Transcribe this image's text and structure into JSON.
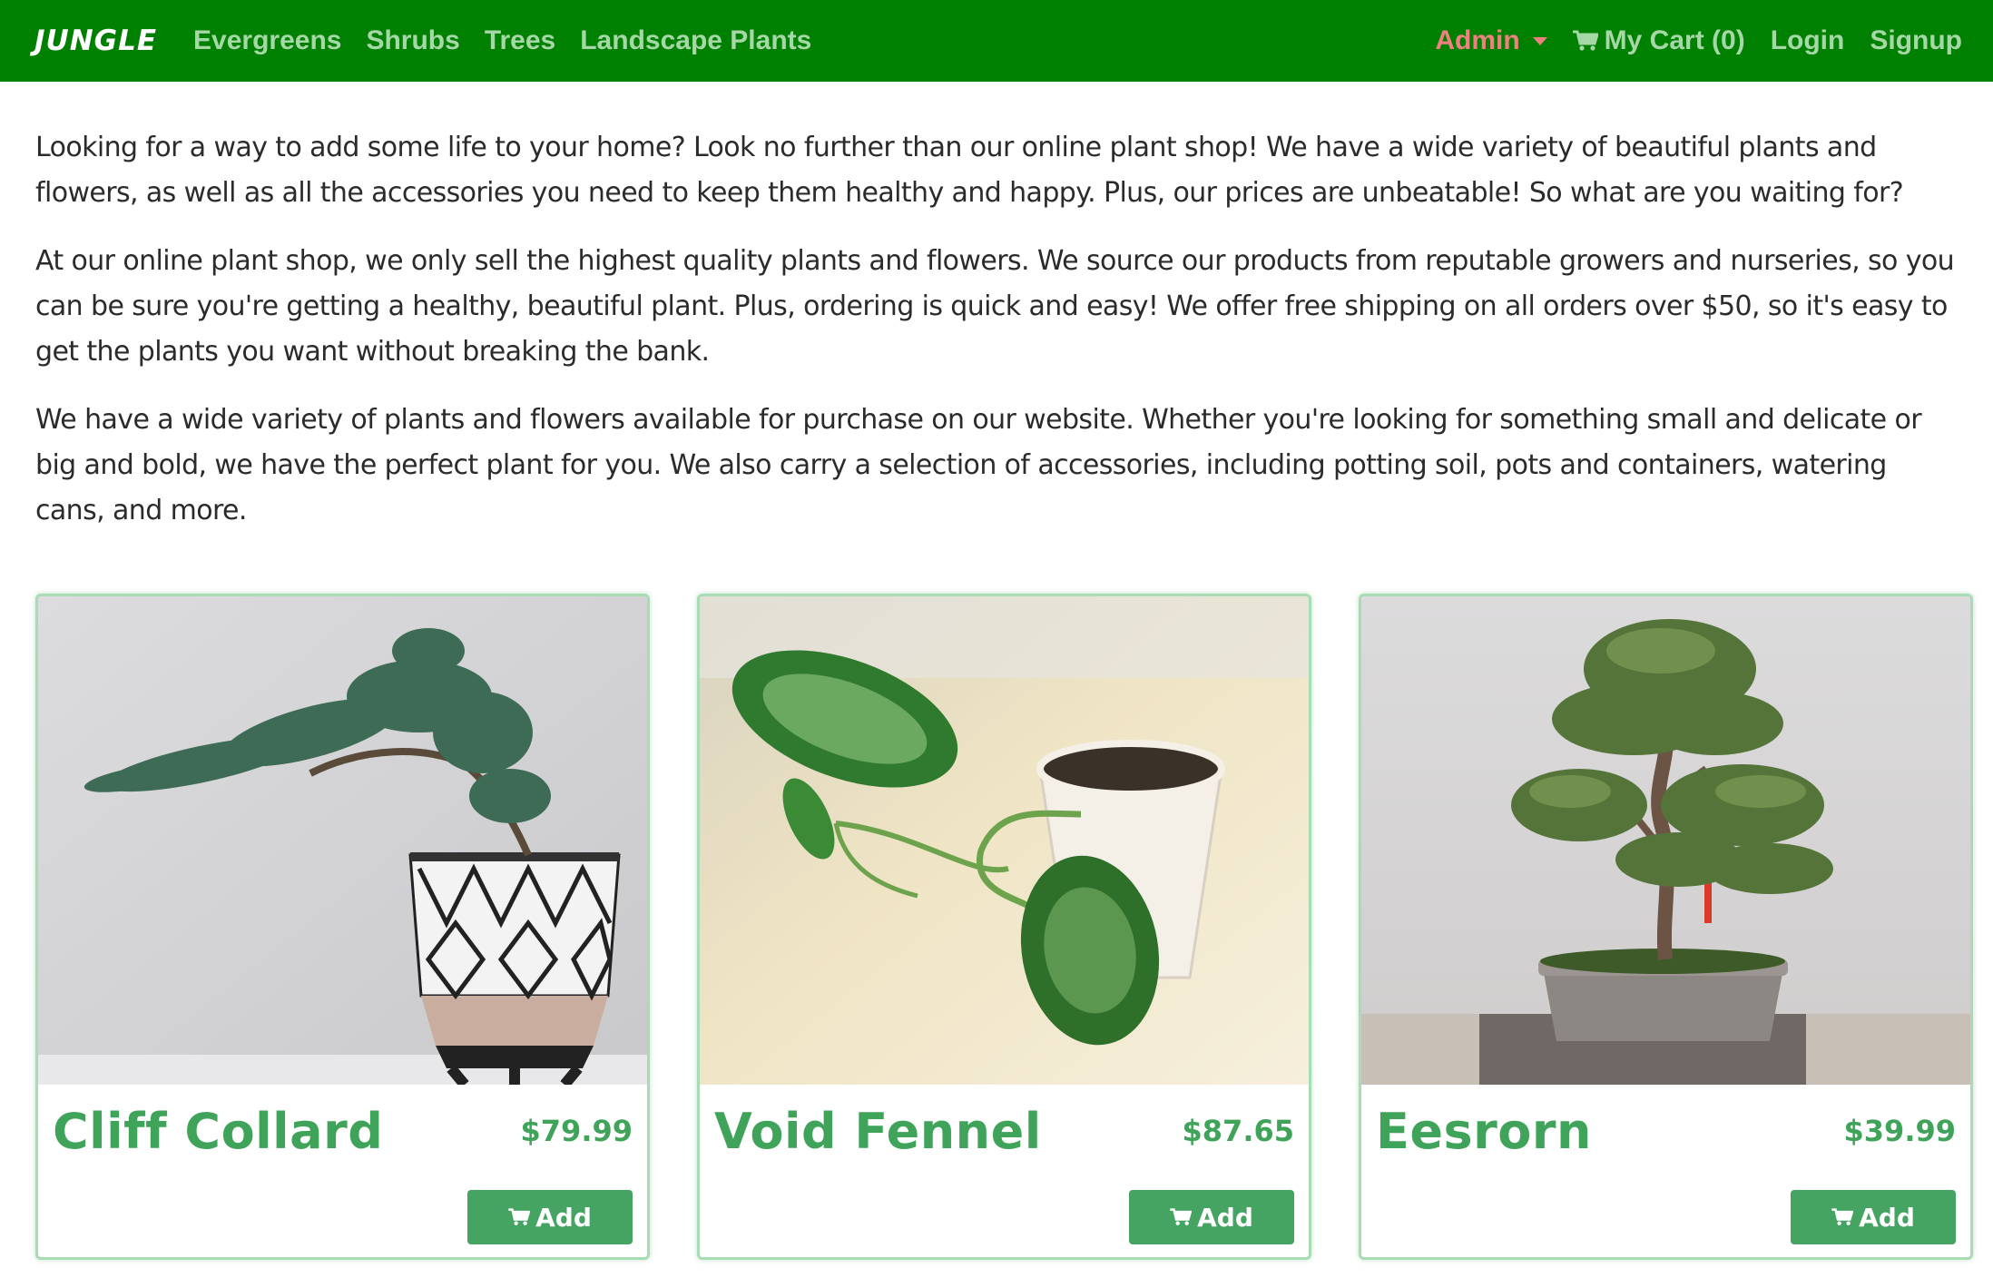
{
  "nav": {
    "brand": "JUNGLE",
    "links": [
      "Evergreens",
      "Shrubs",
      "Trees",
      "Landscape Plants"
    ],
    "admin_label": "Admin",
    "cart_label": "My Cart (0)",
    "login_label": "Login",
    "signup_label": "Signup"
  },
  "intro": {
    "paragraphs": [
      "Looking for a way to add some life to your home? Look no further than our online plant shop! We have a wide variety of beautiful plants and flowers, as well as all the accessories you need to keep them healthy and happy. Plus, our prices are unbeatable! So what are you waiting for?",
      "At our online plant shop, we only sell the highest quality plants and flowers. We source our products from reputable growers and nurseries, so you can be sure you're getting a healthy, beautiful plant. Plus, ordering is quick and easy! We offer free shipping on all orders over $50, so it's easy to get the plants you want without breaking the bank.",
      "We have a wide variety of plants and flowers available for purchase on our website. Whether you're looking for something small and delicate or big and bold, we have the perfect plant for you. We also carry a selection of accessories, including potting soil, pots and containers, watering cans, and more."
    ]
  },
  "products": [
    {
      "name": "Cliff Collard",
      "price": "$79.99",
      "add_label": "Add"
    },
    {
      "name": "Void Fennel",
      "price": "$87.65",
      "add_label": "Add"
    },
    {
      "name": "Eesrorn",
      "price": "$39.99",
      "add_label": "Add"
    }
  ],
  "colors": {
    "navbar": "#008000",
    "nav_link": "#a6d7a6",
    "admin": "#f08080",
    "accent": "#3fa45a",
    "button": "#46a463"
  },
  "icons": {
    "cart": "shopping-cart-icon",
    "add": "shopping-cart-icon",
    "caret": "caret-down-icon"
  }
}
